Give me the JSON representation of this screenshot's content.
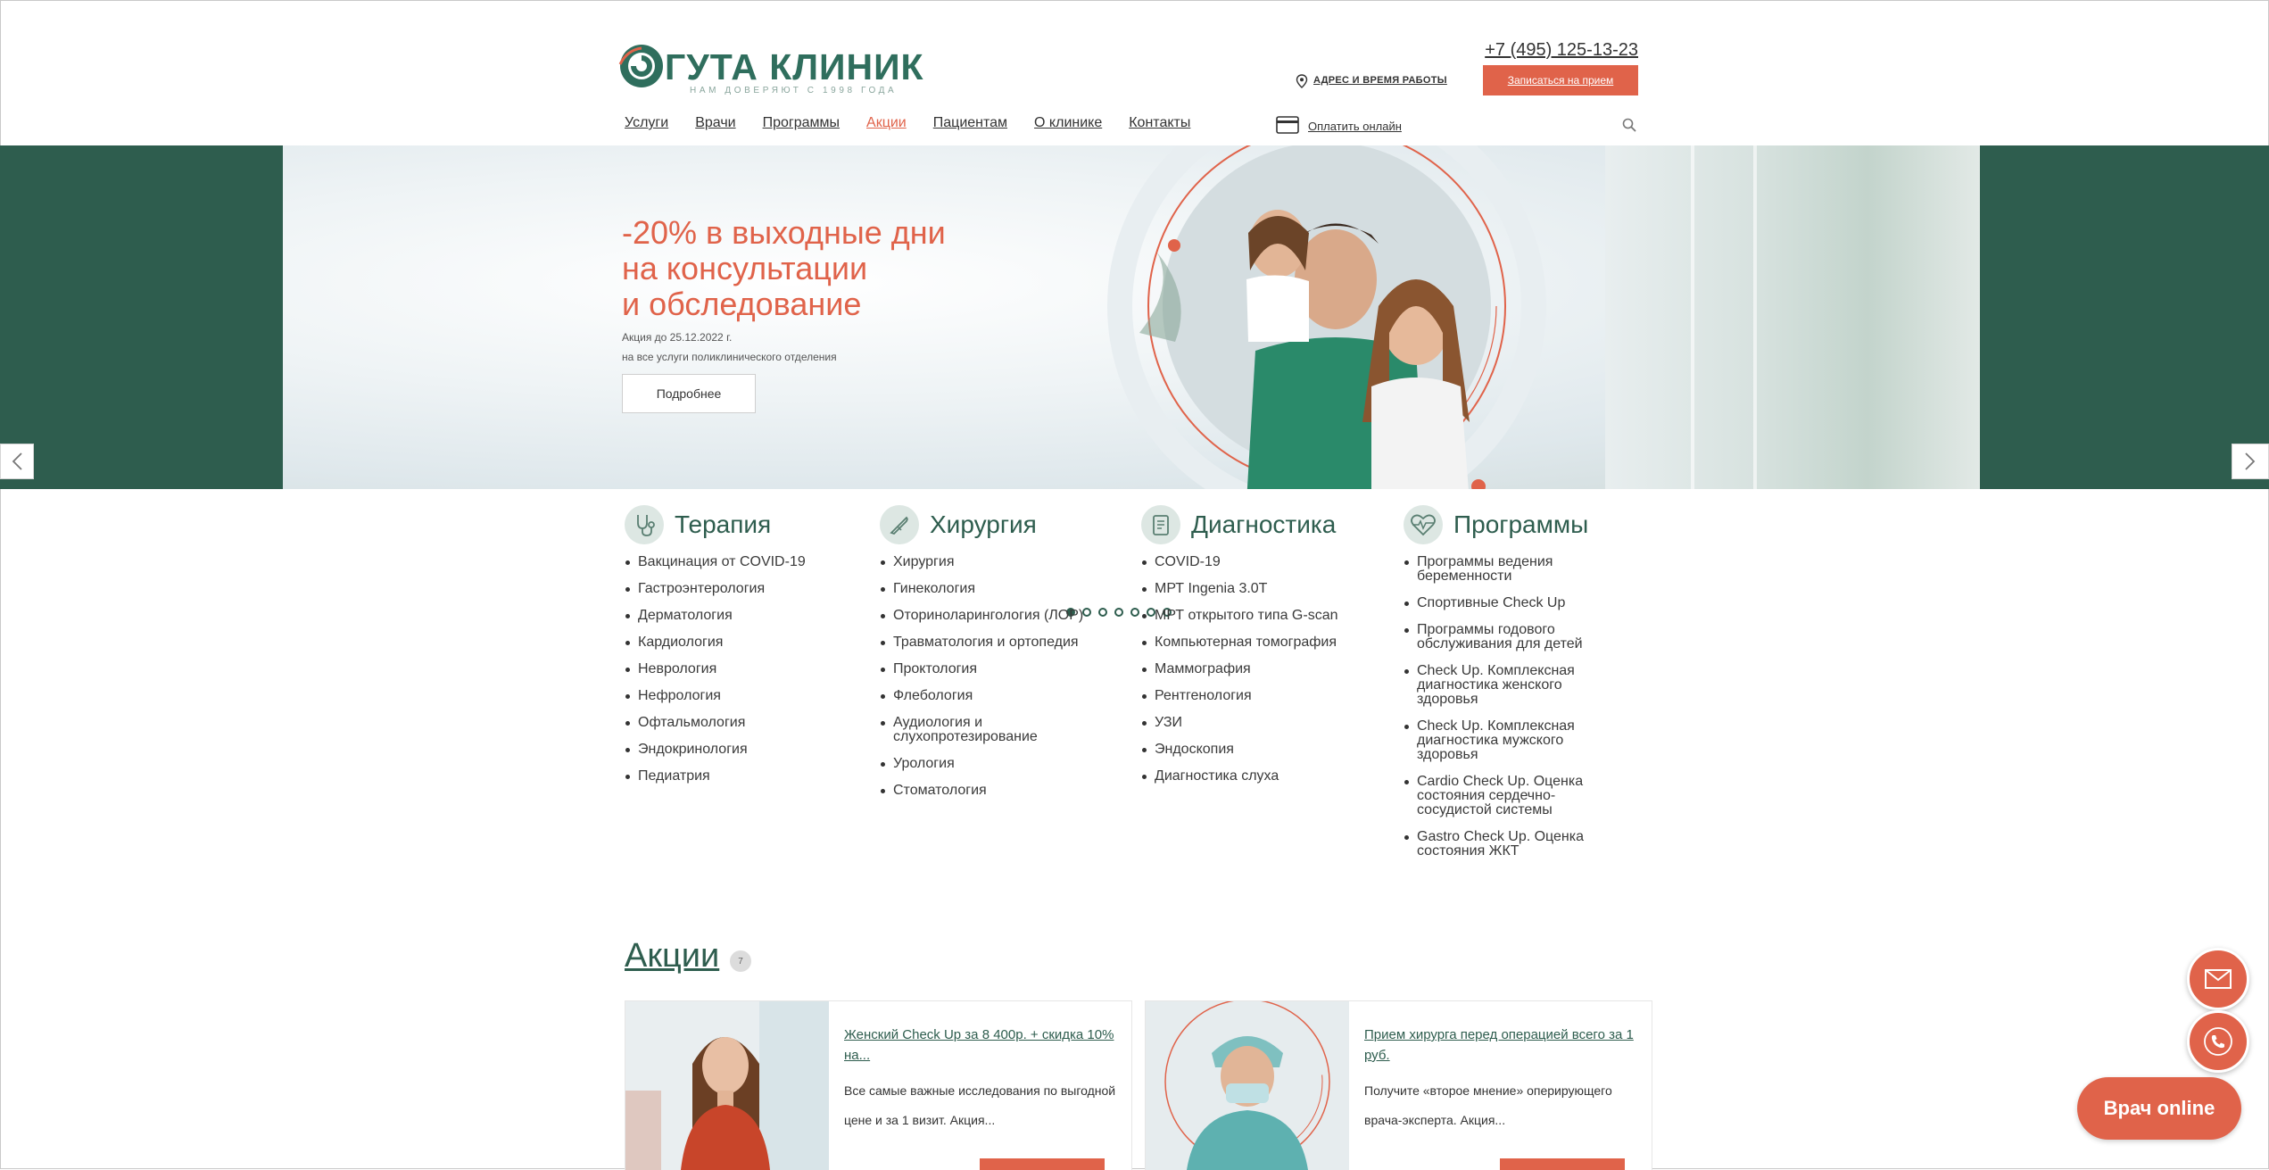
{
  "header": {
    "logo_name": "ГУТА КЛИНИК",
    "logo_tagline": "НАМ ДОВЕРЯЮТ С 1998 ГОДА",
    "phone": "+7 (495) 125-13-23",
    "address_link": "АДРЕС И ВРЕМЯ РАБОТЫ",
    "appointment_button": "Записаться на прием",
    "pay_online": "Оплатить онлайн",
    "nav": [
      {
        "label": "Услуги",
        "active": false
      },
      {
        "label": "Врачи",
        "active": false
      },
      {
        "label": "Программы",
        "active": false
      },
      {
        "label": "Акции",
        "active": true
      },
      {
        "label": "Пациентам",
        "active": false
      },
      {
        "label": "О клинике",
        "active": false
      },
      {
        "label": "Контакты",
        "active": false
      }
    ]
  },
  "hero": {
    "title_lines": [
      "-20% в выходные дни",
      "на консультации",
      "и обследование"
    ],
    "subtitle_1": "Акция до 25.12.2022 г.",
    "subtitle_2": "на все услуги поликлинического отделения",
    "button": "Подробнее",
    "slide_count": 7,
    "active_slide": 1
  },
  "categories": [
    {
      "title": "Терапия",
      "icon": "stethoscope-icon",
      "items": [
        "Вакцинация от COVID-19",
        "Гастроэнтерология",
        "Дерматология",
        "Кардиология",
        "Неврология",
        "Нефрология",
        "Офтальмология",
        "Эндокринология",
        "Педиатрия"
      ]
    },
    {
      "title": "Хирургия",
      "icon": "scalpel-icon",
      "items": [
        "Хирургия",
        "Гинекология",
        "Оториноларингология (ЛОР)",
        "Травматология и ортопедия",
        "Проктология",
        "Флебология",
        "Аудиология и слухопротезирование",
        "Урология",
        "Стоматология"
      ]
    },
    {
      "title": "Диагностика",
      "icon": "clipboard-icon",
      "items": [
        "COVID-19",
        "МРТ Ingenia 3.0T",
        "МРТ открытого типа G-scan",
        "Компьютерная томография",
        "Маммография",
        "Рентгенология",
        "УЗИ",
        "Эндоскопия",
        "Диагностика слуха"
      ]
    },
    {
      "title": "Программы",
      "icon": "heartbeat-icon",
      "items": [
        "Программы ведения беременности",
        "Спортивные Check Up",
        "Программы годового обслуживания для детей",
        "Check Up. Комплексная диагностика женского здоровья",
        "Check Up. Комплексная диагностика мужского здоровья",
        "Cardio Check Up. Оценка состояния сердечно-сосудистой системы",
        "Gastro Check Up. Оценка состояния ЖКТ"
      ]
    }
  ],
  "promos": {
    "title": "Акции",
    "count": "7",
    "cards": [
      {
        "title": "Женский Check Up за 8 400р. + скидка 10% на...",
        "desc": "Все самые важные исследования по выгодной цене и за 1 визит. Акция..."
      },
      {
        "title": "Прием хирурга перед операцией всего за 1 руб.",
        "desc": "Получите «второе мнение» оперирующего врача-эксперта. Акция..."
      }
    ]
  },
  "floating": {
    "doctor_online": "Врач online"
  },
  "colors": {
    "brand_green": "#2e5d4e",
    "accent_coral": "#e0634a"
  }
}
